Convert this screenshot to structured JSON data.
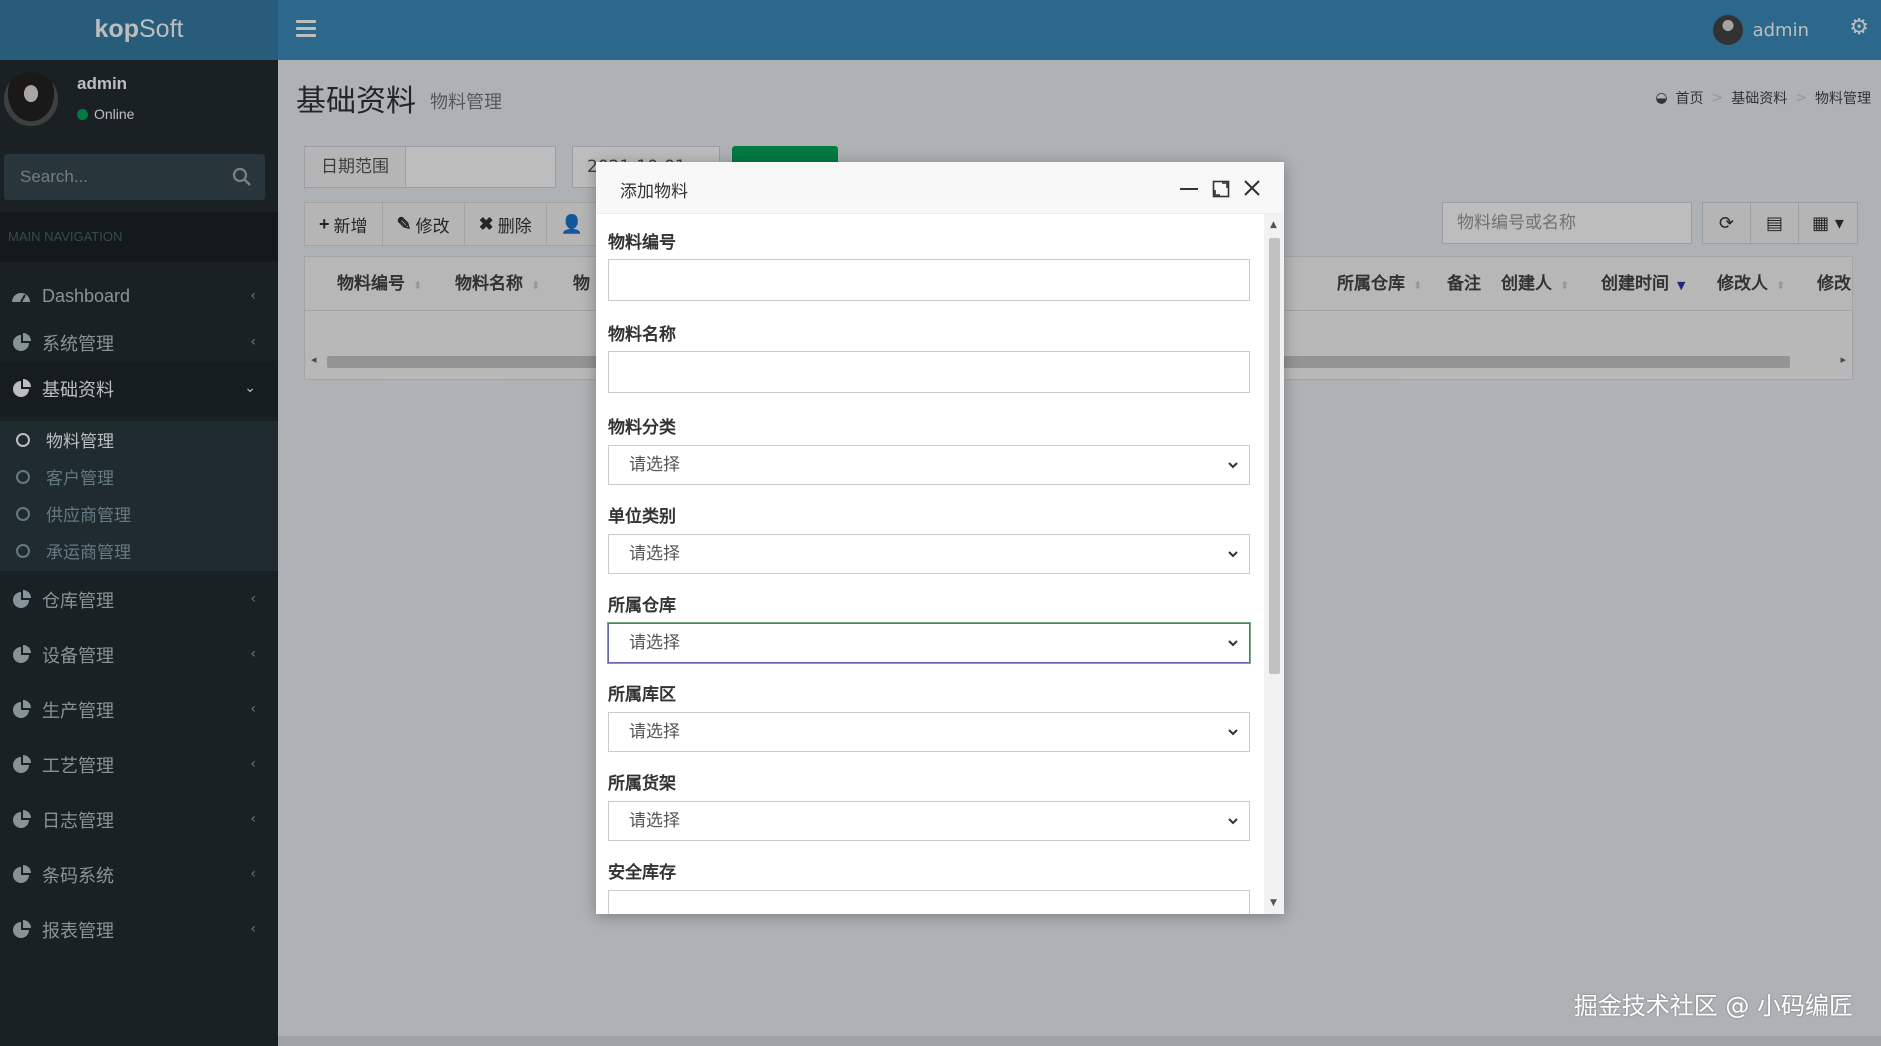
{
  "app": {
    "logo_bold": "kop",
    "logo_rest": "Soft"
  },
  "navbar": {
    "user_name": "admin"
  },
  "sidebar": {
    "user_name": "admin",
    "user_status": "Online",
    "search_placeholder": "Search...",
    "nav_header": "MAIN NAVIGATION",
    "items": [
      {
        "label": "Dashboard"
      },
      {
        "label": "系统管理"
      },
      {
        "label": "基础资料"
      },
      {
        "label": "仓库管理"
      },
      {
        "label": "设备管理"
      },
      {
        "label": "生产管理"
      },
      {
        "label": "工艺管理"
      },
      {
        "label": "日志管理"
      },
      {
        "label": "条码系统"
      },
      {
        "label": "报表管理"
      }
    ],
    "subitems": [
      {
        "label": "物料管理"
      },
      {
        "label": "客户管理"
      },
      {
        "label": "供应商管理"
      },
      {
        "label": "承运商管理"
      }
    ]
  },
  "page": {
    "title": "基础资料",
    "subtitle": "物料管理",
    "breadcrumb": [
      "首页",
      "基础资料",
      "物料管理"
    ]
  },
  "filter": {
    "date_label": "日期范围",
    "date_value": "2021-10-01"
  },
  "toolbar": {
    "add": "新增",
    "edit": "修改",
    "delete": "删除"
  },
  "table": {
    "search_placeholder": "物料编号或名称",
    "columns": [
      "物料编号",
      "物料名称",
      "物",
      "所属仓库",
      "备注",
      "创建人",
      "创建时间",
      "修改人",
      "修改时间"
    ]
  },
  "modal": {
    "title": "添加物料",
    "fields": [
      {
        "label": "物料编号",
        "value": ""
      },
      {
        "label": "物料名称",
        "value": ""
      },
      {
        "label": "物料分类",
        "value": "请选择"
      },
      {
        "label": "单位类别",
        "value": "请选择"
      },
      {
        "label": "所属仓库",
        "value": "请选择"
      },
      {
        "label": "所属库区",
        "value": "请选择"
      },
      {
        "label": "所属货架",
        "value": "请选择"
      },
      {
        "label": "安全库存",
        "value": ""
      }
    ]
  },
  "watermark": "掘金技术社区 @ 小码编匠",
  "colors": {
    "header": "#3c8dbc",
    "logo_bg": "#357ca5",
    "sidebar": "#222d32",
    "success": "#00a65a"
  }
}
